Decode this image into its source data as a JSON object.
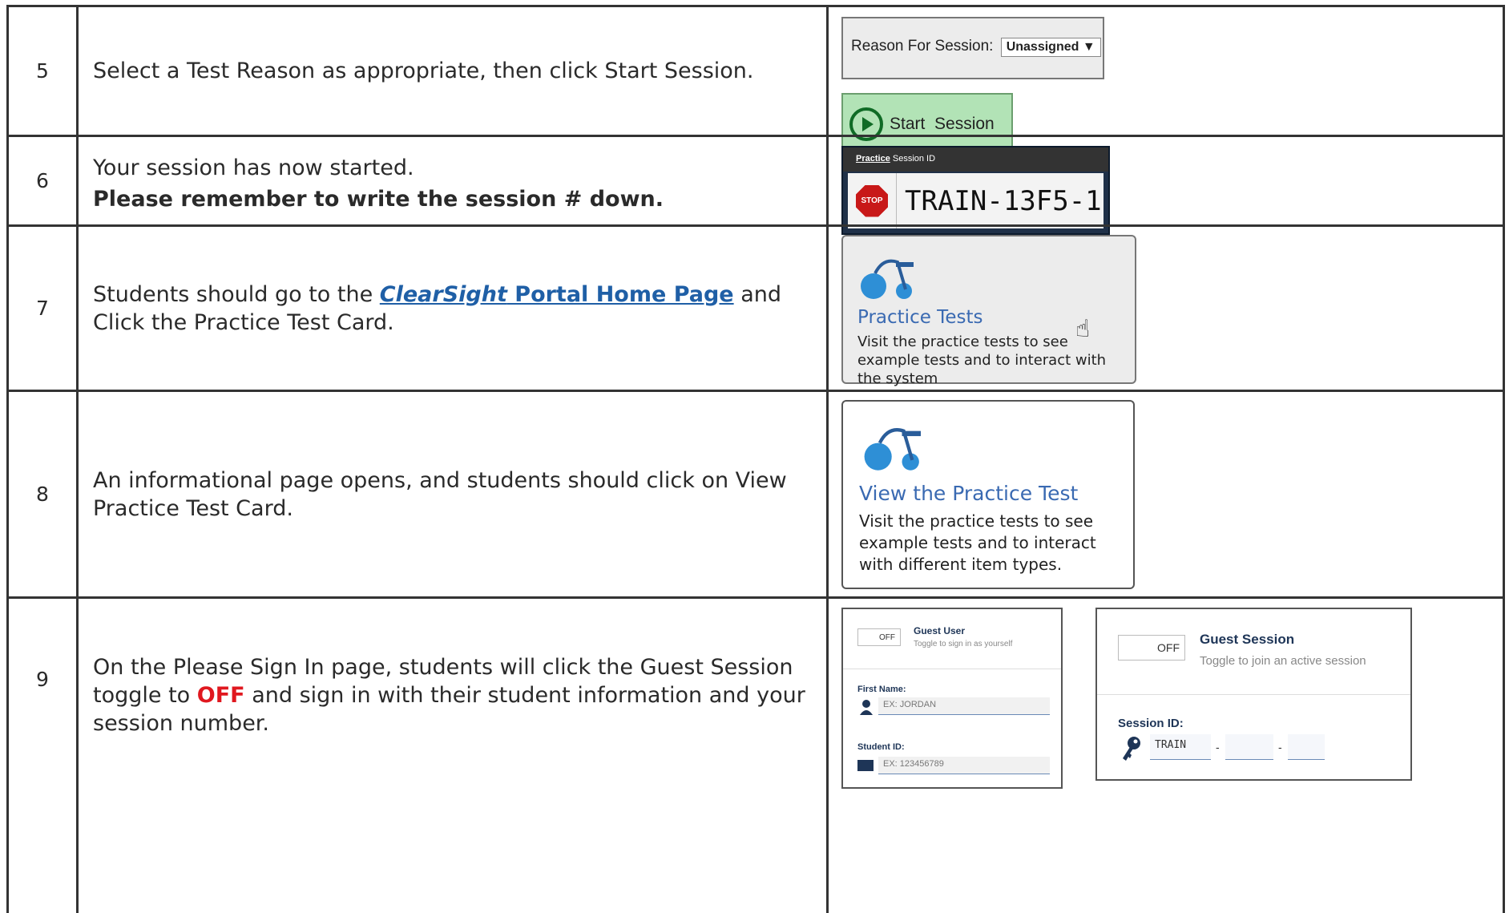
{
  "rows": [
    {
      "step": "5",
      "text": "Select a Test Reason as appropriate, then click Start Session.",
      "reason_label": "Reason For Session:",
      "reason_value": "Unassigned",
      "reason_arrow": "▼",
      "start_label": "Start  Session",
      "start_icon": "play-circle-icon"
    },
    {
      "step": "6",
      "text_line1": "Your session has now started.",
      "text_line2": "Please remember to write the session # down.",
      "panel_label_underline": "Practice",
      "panel_label_rest": " Session ID",
      "stop_label": "STOP",
      "session_id": "TRAIN-13F5-1"
    },
    {
      "step": "7",
      "text_before": "Students should go to the ",
      "link_italic": "ClearSight",
      "link_rest": " Portal Home Page",
      "text_after": " and Click the Practice Test Card.",
      "card_title": "Practice Tests",
      "card_desc": "Visit the practice tests to see example tests and to interact with the system",
      "card_icon": "tricycle-icon",
      "cursor_icon": "hand-pointer-icon"
    },
    {
      "step": "8",
      "text": "An informational page opens, and students should click on View Practice Test Card.",
      "card_title": "View the Practice Test",
      "card_desc": "Visit the practice tests to see example tests and to interact with different item types.",
      "card_icon": "tricycle-icon"
    },
    {
      "step": "9",
      "text_before": "On the Please Sign In page, students will click the Guest Session toggle to ",
      "text_red": "OFF",
      "text_after": " and sign in with their student information and your session number.",
      "guest_user": {
        "toggle": "OFF",
        "title": "Guest User",
        "subtitle": "Toggle to sign in as yourself",
        "first_name_label": "First Name:",
        "first_name_placeholder": "EX: JORDAN",
        "student_id_label": "Student ID:",
        "student_id_placeholder": "EX: 123456789"
      },
      "guest_session": {
        "toggle": "OFF",
        "title": "Guest Session",
        "subtitle": "Toggle to join an active session",
        "session_id_label": "Session ID:",
        "session_part1": "TRAIN",
        "separator": "-"
      }
    }
  ],
  "colors": {
    "accent_green": "#b2e3b6",
    "link_blue": "#1f5fa6",
    "card_blue": "#3a6ab2",
    "icon_blue": "#2e8fd6",
    "alert_red": "#e0181f"
  }
}
